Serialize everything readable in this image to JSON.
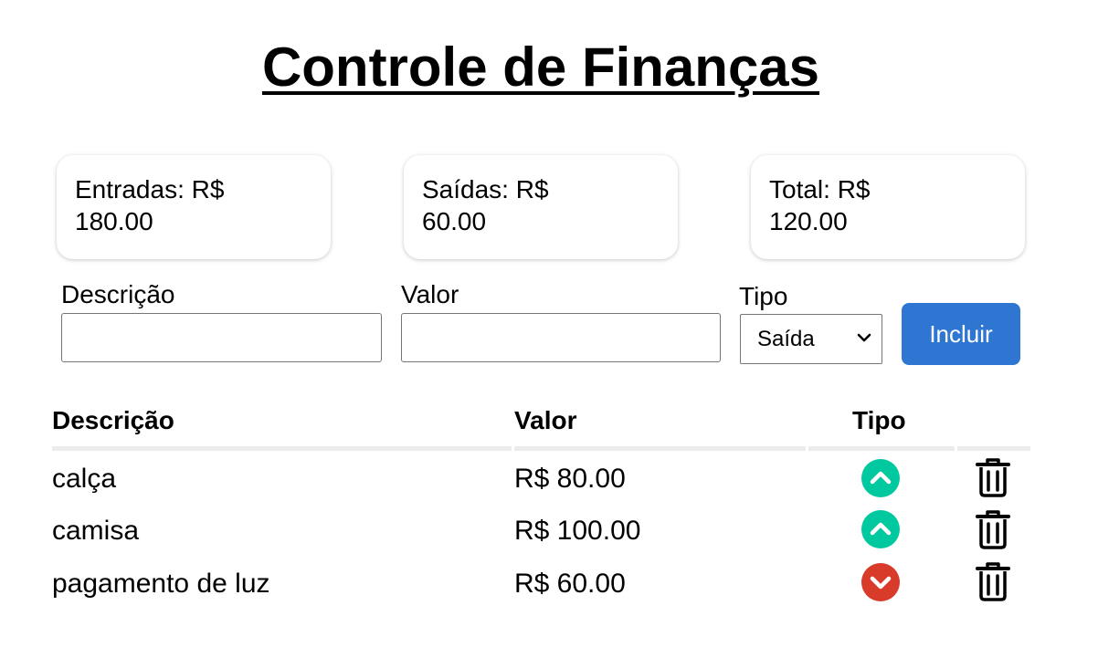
{
  "title": "Controle de Finanças",
  "summary": {
    "income_label": "Entradas: R$",
    "income_value": "180.00",
    "expense_label": "Saídas: R$",
    "expense_value": "60.00",
    "total_label": "Total: R$",
    "total_value": "120.00"
  },
  "form": {
    "description_label": "Descrição",
    "description_value": "",
    "amount_label": "Valor",
    "amount_value": "",
    "type_label": "Tipo",
    "type_selected": "Saída",
    "submit_label": "Incluir"
  },
  "table": {
    "headers": [
      "Descrição",
      "Valor",
      "Tipo"
    ],
    "rows": [
      {
        "description": "calça",
        "amount": "R$ 80.00",
        "type_icon": "arrow-up-circle-icon"
      },
      {
        "description": "camisa",
        "amount": "R$ 100.00",
        "type_icon": "arrow-up-circle-icon"
      },
      {
        "description": "pagamento de luz",
        "amount": "R$ 60.00",
        "type_icon": "arrow-down-circle-icon"
      }
    ]
  },
  "colors": {
    "income": "#00c9a0",
    "expense": "#d93b2b",
    "button": "#2f76d2"
  }
}
